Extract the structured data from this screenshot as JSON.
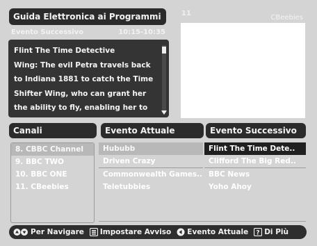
{
  "header": {
    "title": "Guida Elettronica ai Programmi",
    "channel_number": "11",
    "channel_name": "CBeebies"
  },
  "program_info": {
    "label": "Evento Successivo",
    "time": "10:15-10:35",
    "synopsis": "Flint The Time Detective\nWing: The evil Petra travels back\nto Indiana 1881 to catch the Time\nShifter Wing, who can grant her\nthe ability to fly, enabling her to"
  },
  "columns": {
    "canali": "Canali",
    "attuale": "Evento Attuale",
    "successivo": "Evento Successivo"
  },
  "channels": [
    {
      "label": "8. CBBC Channel"
    },
    {
      "label": "9. BBC TWO"
    },
    {
      "label": "10. BBC ONE"
    },
    {
      "label": "11. CBeebies"
    }
  ],
  "current_events": [
    {
      "label": "Hububb"
    },
    {
      "label": "Driven Crazy"
    },
    {
      "label": "Commonwealth Games.."
    },
    {
      "label": "Teletubbies"
    }
  ],
  "next_events": [
    {
      "label": "Flint The Time Dete.."
    },
    {
      "label": "Clifford The Big Red.."
    },
    {
      "label": "BBC News"
    },
    {
      "label": "Yoho Ahoy"
    }
  ],
  "footer": {
    "navigate": "Per Navigare",
    "reminder": "Impostare Avviso",
    "current": "Evento Attuale",
    "more": "Di Più"
  },
  "colors": {
    "background": "#d4d4d4",
    "panel": "#2b2b2b",
    "highlight": "#202020",
    "text": "#ffffff"
  },
  "icons": {
    "navigate": "up-down-arrows-icon",
    "reminder": "reminder-button-icon",
    "current": "left-arrow-icon",
    "more": "info-button-icon"
  }
}
